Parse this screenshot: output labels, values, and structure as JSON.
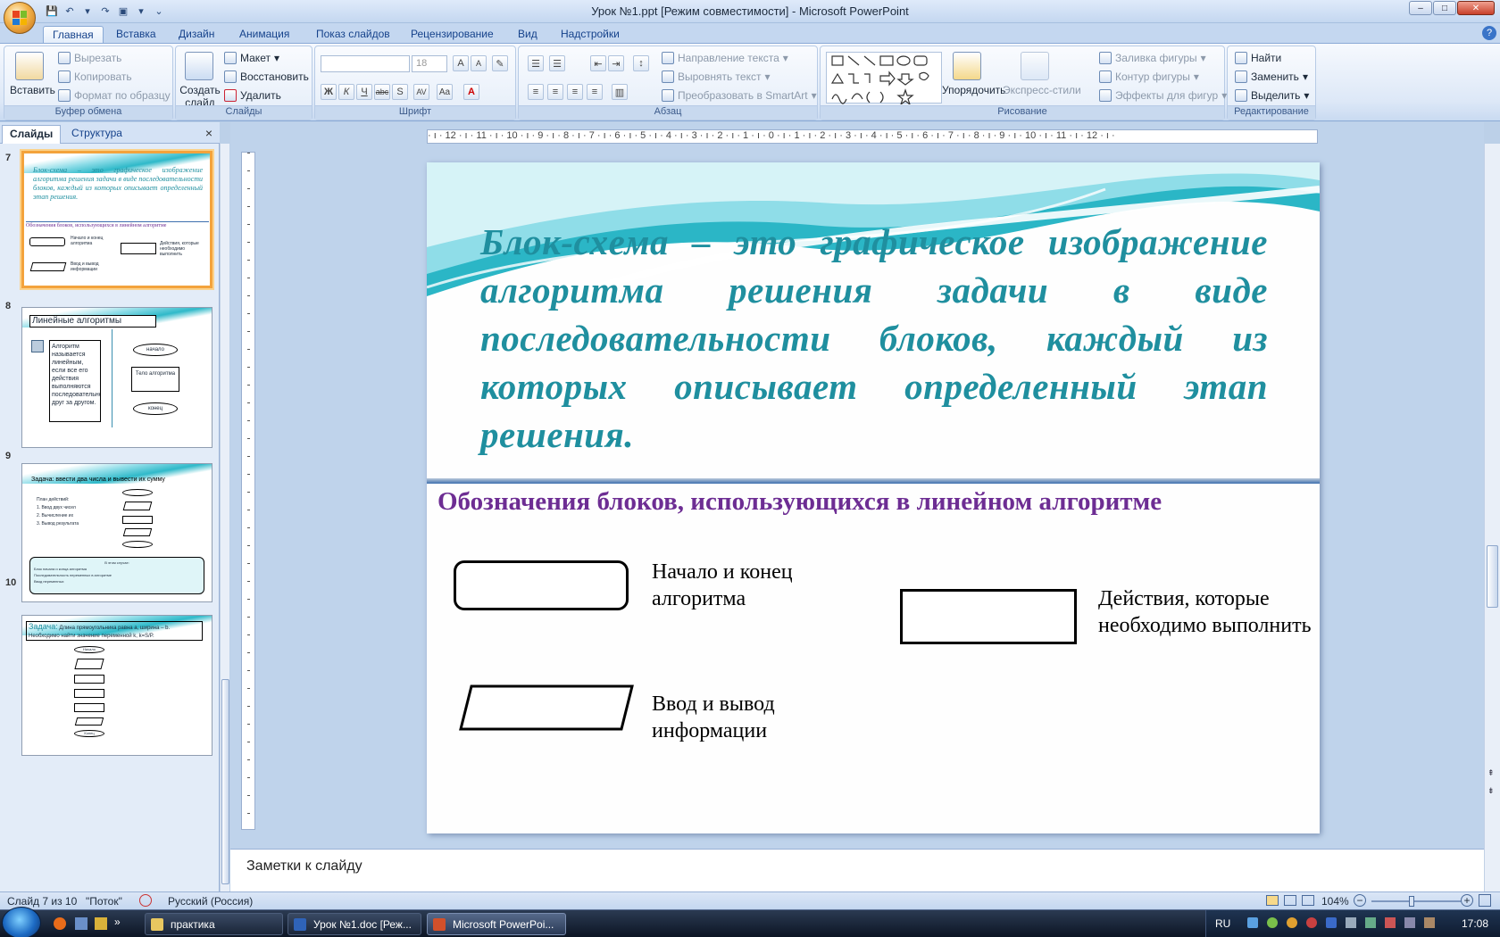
{
  "window": {
    "title": "Урок №1.ppt [Режим совместимости] - Microsoft PowerPoint",
    "controls": [
      "–",
      "□",
      "✕"
    ]
  },
  "tabs": [
    "Главная",
    "Вставка",
    "Дизайн",
    "Анимация",
    "Показ слайдов",
    "Рецензирование",
    "Вид",
    "Надстройки"
  ],
  "ribbon": {
    "clipboard": {
      "title": "Буфер обмена",
      "paste": "Вставить",
      "cut": "Вырезать",
      "copy": "Копировать",
      "format": "Формат по образцу"
    },
    "slides": {
      "title": "Слайды",
      "create": "Создать слайд",
      "layout": "Макет",
      "restore": "Восстановить",
      "delete": "Удалить"
    },
    "font": {
      "title": "Шрифт",
      "size": "18",
      "bold": "Ж",
      "italic": "К",
      "underline": "Ч",
      "strike": "abc",
      "shadow": "S",
      "spacing": "AV",
      "case": "Aa",
      "color": "A",
      "grow": "A",
      "shrink": "A"
    },
    "paragraph": {
      "title": "Абзац",
      "direction": "Направление текста",
      "align": "Выровнять текст",
      "smartart": "Преобразовать в SmartArt"
    },
    "drawing": {
      "title": "Рисование",
      "arrange": "Упорядочить",
      "quick_styles": "Экспресс-стили",
      "fill": "Заливка фигуры",
      "outline": "Контур фигуры",
      "effects": "Эффекты для фигур"
    },
    "editing": {
      "title": "Редактирование",
      "find": "Найти",
      "replace": "Заменить",
      "select": "Выделить"
    }
  },
  "panel": {
    "tabs": [
      "Слайды",
      "Структура"
    ],
    "close": "×",
    "thumbs": [
      {
        "num": "7",
        "text": "Блок-схема – это графическое изображение алгоритма решения задачи в виде последовательности блоков, каждый из которых описывает определенный этап решения.",
        "sub": "Обозначения блоков, использующихся в линейном алгоритме",
        "l1": "Начало и конец алгоритма",
        "l2": "Действия, которые необходимо выполнить",
        "l3": "Ввод и вывод информации"
      },
      {
        "num": "8",
        "title": "Линейные алгоритмы",
        "body": "Алгоритм называется линейным, если все его действия выполняются последовательно друг за другом.",
        "start": "начало",
        "mid": "Тело алгоритма",
        "end": "конец"
      },
      {
        "num": "9",
        "title": "Задача: ввести два числа и вывести их сумму",
        "plan": "План действий:",
        "s1": "1. Ввод двух чисел",
        "s2": "2. Вычисление их",
        "s3": "3. Вывод результата",
        "box": "В этом случае:",
        "b1": "Блок начала и конца алгоритма",
        "b2": "Последовательность переменных в алгоритме",
        "b3": "Ввод переменных"
      },
      {
        "num": "10",
        "title": "Задача:",
        "body": "Длина прямоугольника равна a, ширина – b. Необходимо найти значение переменной k, k=S/P.",
        "start": "Начало",
        "end": "Конец"
      }
    ]
  },
  "ruler": {
    "h": "· ı · 12 · ı · 11 · ı · 10 · ı · 9 · ı · 8 · ı · 7 · ı · 6 · ı · 5 · ı · 4 · ı · 3 · ı · 2 · ı · 1 · ı · 0 · ı · 1 · ı · 2 · ı · 3 · ı · 4 · ı · 5 · ı · 6 · ı · 7 · ı · 8 · ı · 9 · ı · 10 · ı · 11 · ı · 12 · ı ·"
  },
  "slide": {
    "definition": "Блок-схема – это графическое изображение алгоритма решения задачи в виде последовательности блоков, каждый из которых описывает определенный этап решения.",
    "subtitle": "Обозначения блоков, использующихся в линейном алгоритме",
    "labels": {
      "start_end": "Начало и конец алгоритма",
      "actions": "Действия, которые необходимо выполнить",
      "io": "Ввод и вывод информации"
    },
    "colors": {
      "definition": "#1f8f9f",
      "subtitle": "#6d2d93"
    }
  },
  "notes": {
    "placeholder": "Заметки к слайду"
  },
  "status": {
    "slide": "Слайд 7 из 10",
    "theme": "\"Поток\"",
    "language": "Русский (Россия)",
    "zoom": "104%"
  },
  "taskbar": {
    "items": [
      "практика",
      "Урок №1.doc [Реж...",
      "Microsoft PowerPoi..."
    ],
    "lang": "RU",
    "time": "17:08"
  }
}
